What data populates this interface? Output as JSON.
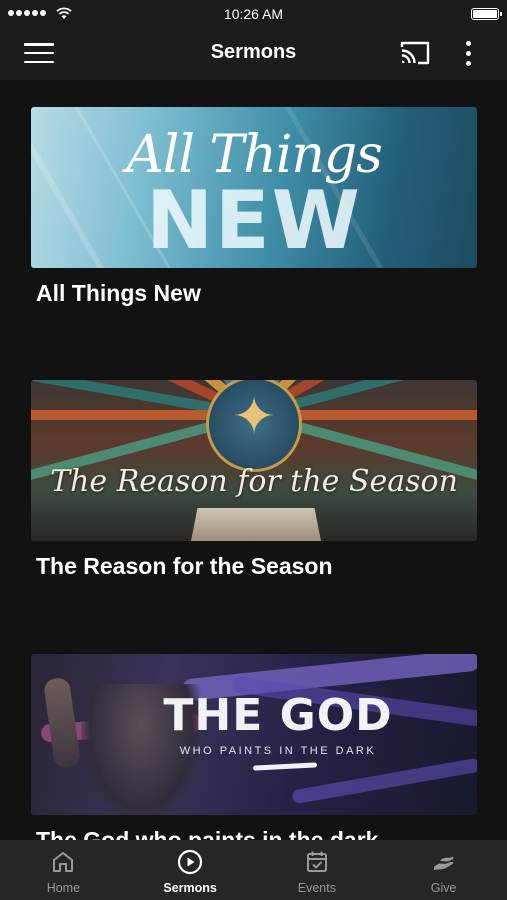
{
  "status_bar": {
    "time": "10:26 AM"
  },
  "app_bar": {
    "title": "Sermons"
  },
  "sermons": [
    {
      "title": "All Things New",
      "art_script": "All Things",
      "art_big": "NEW"
    },
    {
      "title": "The Reason for the Season",
      "art_text": "The Reason for the Season"
    },
    {
      "title": "The God who paints in the dark",
      "art_title": "THE GOD",
      "art_sub": "WHO PAINTS IN THE DARK"
    }
  ],
  "bottom_nav": {
    "items": [
      {
        "label": "Home",
        "icon": "home-icon"
      },
      {
        "label": "Sermons",
        "icon": "play-circle-icon",
        "active": true
      },
      {
        "label": "Events",
        "icon": "calendar-check-icon"
      },
      {
        "label": "Give",
        "icon": "giving-hand-icon"
      }
    ]
  },
  "colors": {
    "background": "#121212",
    "bar": "#1c1c1c",
    "nav": "#262626",
    "inactive": "#9a9a9a",
    "active": "#ffffff"
  }
}
